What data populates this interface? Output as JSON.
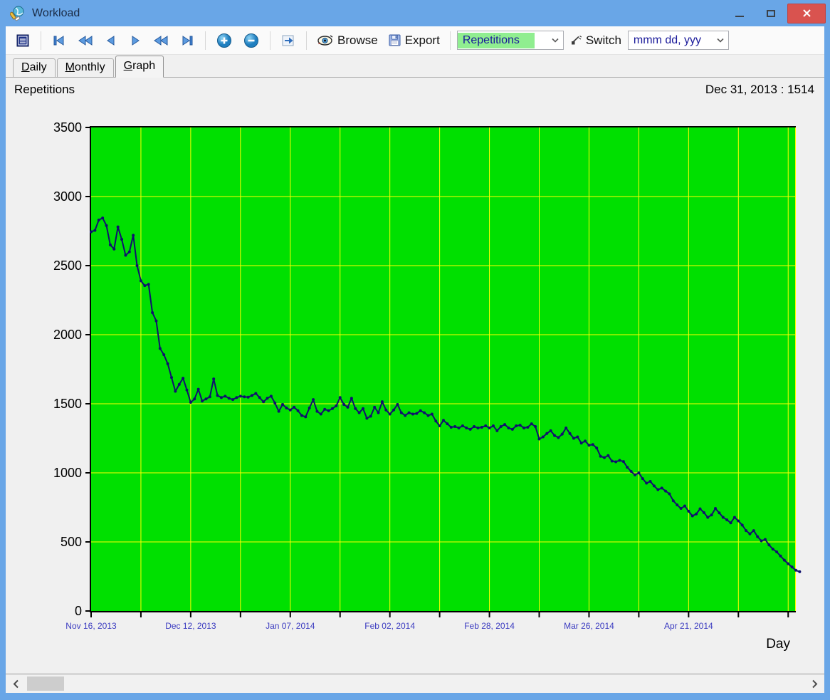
{
  "window": {
    "title": "Workload"
  },
  "toolbar": {
    "browse_label": "Browse",
    "export_label": "Export",
    "switch_label": "Switch",
    "series_combo": {
      "value": "Repetitions",
      "highlight_color": "#90ee90"
    },
    "date_format_combo": {
      "value": "mmm dd, yyy"
    },
    "icons": [
      "menu-icon",
      "first-record-icon",
      "fast-rewind-icon",
      "previous-icon",
      "next-icon",
      "fast-forward-icon",
      "last-record-icon",
      "zoom-in-icon",
      "zoom-out-icon",
      "goto-current-icon",
      "eye-icon",
      "save-icon",
      "switch-icon"
    ]
  },
  "tabs": [
    {
      "key": "D",
      "rest": "aily",
      "active": false
    },
    {
      "key": "M",
      "rest": "onthly",
      "active": false
    },
    {
      "key": "G",
      "rest": "raph",
      "active": true
    }
  ],
  "header": {
    "series_title": "Repetitions",
    "cursor_readout": "Dec 31, 2013 : 1514"
  },
  "colors": {
    "titlebar": "#69a6e7",
    "close_button": "#d9534f",
    "content_bg": "#f0f0f0"
  },
  "chart_data": {
    "type": "line",
    "title": "Repetitions",
    "xlabel": "Day",
    "ylim": [
      0,
      3500
    ],
    "ytick_step": 500,
    "total_days": 184,
    "x_minor_step": 13,
    "grid": true,
    "plot_bg": "#00e000",
    "grid_color": "#ffff00",
    "x_label_color": "#3b3bc0",
    "x_axis_labels": [
      {
        "day": 0,
        "label": "Nov 16, 2013"
      },
      {
        "day": 26,
        "label": "Dec 12, 2013"
      },
      {
        "day": 52,
        "label": "Jan 07, 2014"
      },
      {
        "day": 78,
        "label": "Feb 02, 2014"
      },
      {
        "day": 104,
        "label": "Feb 28, 2014"
      },
      {
        "day": 130,
        "label": "Mar 26, 2014"
      },
      {
        "day": 156,
        "label": "Apr 21, 2014"
      }
    ],
    "series": [
      {
        "name": "Repetitions",
        "color": "#10106e",
        "values": [
          2745,
          2755,
          2830,
          2845,
          2790,
          2650,
          2620,
          2780,
          2690,
          2575,
          2600,
          2720,
          2500,
          2390,
          2355,
          2365,
          2160,
          2100,
          1900,
          1855,
          1790,
          1690,
          1590,
          1640,
          1685,
          1600,
          1510,
          1535,
          1605,
          1520,
          1535,
          1550,
          1680,
          1560,
          1545,
          1555,
          1540,
          1530,
          1545,
          1555,
          1550,
          1548,
          1560,
          1575,
          1545,
          1514,
          1540,
          1555,
          1505,
          1445,
          1495,
          1470,
          1455,
          1475,
          1450,
          1415,
          1405,
          1470,
          1530,
          1445,
          1425,
          1460,
          1450,
          1465,
          1485,
          1545,
          1495,
          1475,
          1540,
          1465,
          1435,
          1465,
          1395,
          1410,
          1475,
          1435,
          1515,
          1455,
          1425,
          1455,
          1495,
          1435,
          1415,
          1435,
          1425,
          1430,
          1450,
          1435,
          1415,
          1425,
          1375,
          1340,
          1380,
          1355,
          1330,
          1335,
          1325,
          1340,
          1325,
          1315,
          1335,
          1325,
          1330,
          1340,
          1325,
          1340,
          1305,
          1335,
          1350,
          1325,
          1315,
          1340,
          1345,
          1325,
          1330,
          1355,
          1335,
          1245,
          1260,
          1285,
          1305,
          1270,
          1255,
          1280,
          1325,
          1285,
          1250,
          1260,
          1215,
          1230,
          1200,
          1205,
          1180,
          1120,
          1110,
          1125,
          1085,
          1080,
          1090,
          1082,
          1040,
          1010,
          985,
          1000,
          958,
          925,
          938,
          905,
          878,
          890,
          868,
          848,
          798,
          768,
          742,
          760,
          722,
          688,
          702,
          740,
          712,
          678,
          695,
          742,
          710,
          678,
          660,
          638,
          678,
          652,
          622,
          582,
          558,
          582,
          538,
          508,
          518,
          478,
          448,
          428,
          398,
          368,
          342,
          318,
          295,
          284
        ]
      }
    ]
  }
}
